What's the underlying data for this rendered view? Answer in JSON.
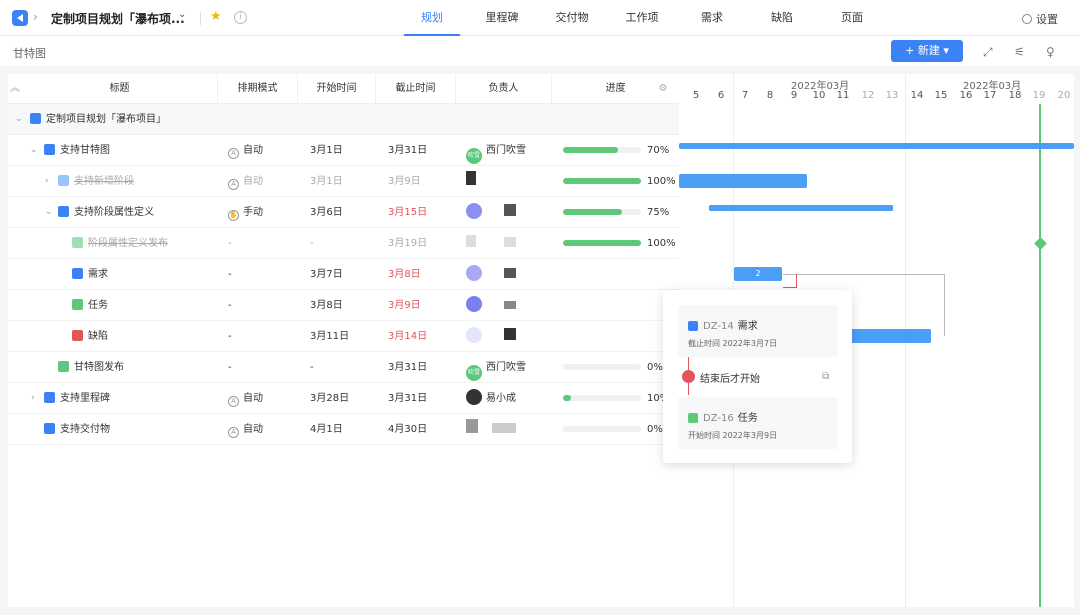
{
  "topbar": {
    "project_title": "定制项目规划「瀑布项...",
    "tabs": [
      "规划",
      "里程碑",
      "交付物",
      "工作项",
      "需求",
      "缺陷",
      "页面"
    ],
    "active_tab": "规划",
    "settings_label": "设置"
  },
  "toolbar": {
    "view_label": "甘特图",
    "new_button": "+ 新建 ▾"
  },
  "table": {
    "headers": {
      "title": "标题",
      "mode": "排期模式",
      "start": "开始时间",
      "end": "截止时间",
      "owner": "负责人",
      "progress": "进度"
    },
    "rows": [
      {
        "title": "定制项目规划「瀑布项目」",
        "mode": "",
        "start": "",
        "end": "",
        "owner": "",
        "progress": "",
        "icon_color": "#3b82f6"
      },
      {
        "title": "支持甘特图",
        "mode": "自动",
        "start": "3月1日",
        "end": "3月31日",
        "owner": "西门吹雪",
        "progress": "70%",
        "progress_value": 0.7,
        "icon_color": "#3b82f6"
      },
      {
        "title": "支持新增阶段",
        "mode": "自动",
        "start": "3月1日",
        "end": "3月9日",
        "owner": "",
        "progress": "100%",
        "progress_value": 1.0,
        "icon_color": "#3b82f6"
      },
      {
        "title": "支持阶段属性定义",
        "mode": "手动",
        "start": "3月6日",
        "end": "3月15日",
        "owner": "",
        "progress": "75%",
        "progress_value": 0.75,
        "icon_color": "#3b82f6"
      },
      {
        "title": "阶段属性定义发布",
        "mode": "-",
        "start": "-",
        "end": "3月19日",
        "owner": "",
        "progress": "100%",
        "progress_value": 1.0,
        "icon_color": "#5bc87a"
      },
      {
        "title": "需求",
        "mode": "-",
        "start": "3月7日",
        "end": "3月8日",
        "owner": "",
        "progress": "",
        "icon_color": "#3b82f6"
      },
      {
        "title": "任务",
        "mode": "-",
        "start": "3月8日",
        "end": "3月9日",
        "owner": "",
        "progress": "",
        "icon_color": "#5bc87a"
      },
      {
        "title": "缺陷",
        "mode": "-",
        "start": "3月11日",
        "end": "3月14日",
        "owner": "",
        "progress": "",
        "icon_color": "#e2555a"
      },
      {
        "title": "甘特图发布",
        "mode": "-",
        "start": "-",
        "end": "3月31日",
        "owner": "西门吹雪",
        "progress": "0%",
        "progress_value": 0.0,
        "icon_color": "#5bc87a"
      },
      {
        "title": "支持里程碑",
        "mode": "自动",
        "start": "3月28日",
        "end": "3月31日",
        "owner": "易小成",
        "progress": "10%",
        "progress_value": 0.1,
        "icon_color": "#3b82f6"
      },
      {
        "title": "支持交付物",
        "mode": "自动",
        "start": "4月1日",
        "end": "4月30日",
        "owner": "",
        "progress": "0%",
        "progress_value": 0.0,
        "icon_color": "#3b82f6"
      }
    ]
  },
  "gantt": {
    "month_labels": [
      "2022年03月",
      "2022年03月"
    ],
    "days": [
      "5",
      "6",
      "7",
      "8",
      "9",
      "10",
      "11",
      "12",
      "13",
      "14",
      "15",
      "16",
      "17",
      "18",
      "19",
      "20"
    ],
    "bar_badge": "2"
  },
  "popup": {
    "item1_id": "DZ-14",
    "item1_name": "需求",
    "item1_date": "截止时间  2022年3月7日",
    "link_label": "结束后才开始",
    "item2_id": "DZ-16",
    "item2_name": "任务",
    "item2_date": "开始时间  2022年3月9日"
  },
  "avatar_labels": {
    "ximen": "吹雪"
  }
}
